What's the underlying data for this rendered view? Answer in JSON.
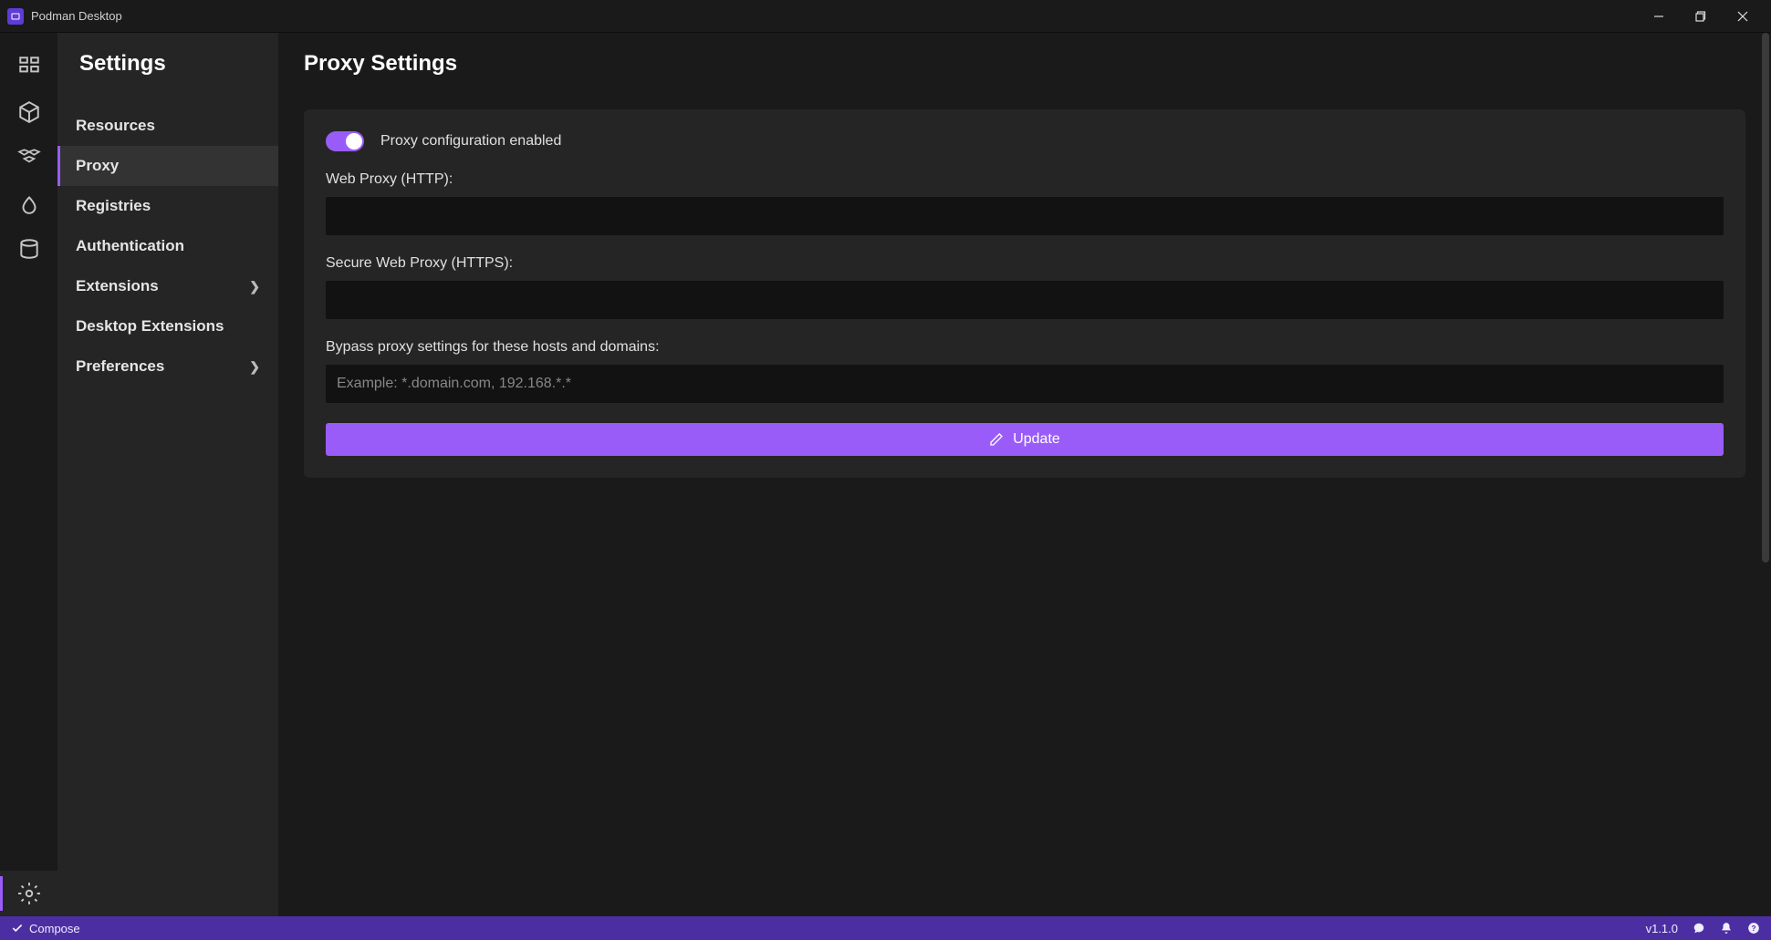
{
  "app": {
    "title": "Podman Desktop"
  },
  "sidebar": {
    "heading": "Settings",
    "items": [
      {
        "label": "Resources",
        "expandable": false,
        "selected": false
      },
      {
        "label": "Proxy",
        "expandable": false,
        "selected": true
      },
      {
        "label": "Registries",
        "expandable": false,
        "selected": false
      },
      {
        "label": "Authentication",
        "expandable": false,
        "selected": false
      },
      {
        "label": "Extensions",
        "expandable": true,
        "selected": false
      },
      {
        "label": "Desktop Extensions",
        "expandable": false,
        "selected": false
      },
      {
        "label": "Preferences",
        "expandable": true,
        "selected": false
      }
    ]
  },
  "page": {
    "title": "Proxy Settings",
    "toggle_label": "Proxy configuration enabled",
    "toggle_on": true,
    "fields": {
      "http_label": "Web Proxy (HTTP):",
      "http_value": "",
      "https_label": "Secure Web Proxy (HTTPS):",
      "https_value": "",
      "bypass_label": "Bypass proxy settings for these hosts and domains:",
      "bypass_value": "",
      "bypass_placeholder": "Example: *.domain.com, 192.168.*.*"
    },
    "update_button": "Update"
  },
  "activitybar": {
    "items": [
      "dashboard",
      "containers",
      "pods",
      "images",
      "volumes"
    ],
    "bottom": "settings"
  },
  "statusbar": {
    "compose": "Compose",
    "version": "v1.1.0"
  },
  "colors": {
    "accent": "#9a5cf8",
    "statusbar": "#4c2ea3"
  }
}
